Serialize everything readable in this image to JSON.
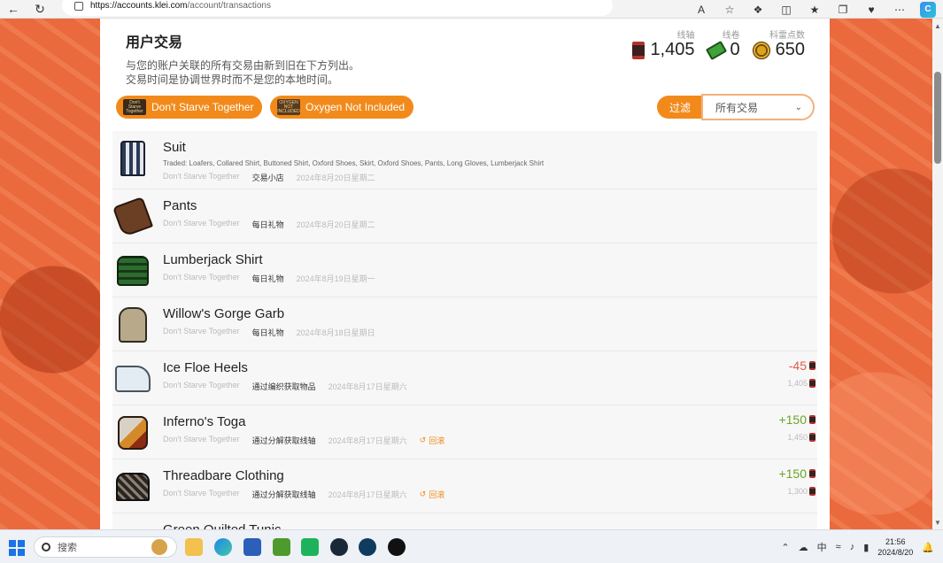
{
  "browser": {
    "url_host": "https://accounts.klei.com",
    "url_path": "/account/transactions",
    "icons": [
      "back-icon",
      "refresh-icon",
      "read-aloud-icon",
      "favorite-icon",
      "extensions-icon",
      "split-screen-icon",
      "favorites-icon",
      "collections-icon",
      "performance-icon",
      "more-icon",
      "copilot-icon"
    ]
  },
  "page": {
    "title": "用户交易",
    "desc_line1": "与您的账户关联的所有交易由新到旧在下方列出。",
    "desc_line2": "交易时间是协调世界时而不是您的本地时间。"
  },
  "balances": [
    {
      "label": "线轴",
      "value": "1,405",
      "icon": "spool-icon"
    },
    {
      "label": "线卷",
      "value": "0",
      "icon": "ticket-icon"
    },
    {
      "label": "科雷点数",
      "value": "650",
      "icon": "klei-points-icon"
    }
  ],
  "filters": {
    "games": [
      {
        "label": "Don't Starve Together",
        "logo_text": "Don't Starve Together"
      },
      {
        "label": "Oxygen Not Included",
        "logo_text": "OXYGEN NOT INCLUDED"
      }
    ],
    "filter_label": "过滤",
    "filter_value": "所有交易"
  },
  "transactions": [
    {
      "title": "Suit",
      "detail": "Traded: Loafers, Collared Shirt, Buttoned Shirt, Oxford Shoes, Skirt, Oxford Shoes, Pants, Long Gloves, Lumberjack Shirt",
      "game": "Don't Starve Together",
      "type": "交易小店",
      "date": "2024年8月20日星期二"
    },
    {
      "title": "Pants",
      "game": "Don't Starve Together",
      "type": "每日礼物",
      "date": "2024年8月20日星期二"
    },
    {
      "title": "Lumberjack Shirt",
      "game": "Don't Starve Together",
      "type": "每日礼物",
      "date": "2024年8月19日星期一"
    },
    {
      "title": "Willow's Gorge Garb",
      "game": "Don't Starve Together",
      "type": "每日礼物",
      "date": "2024年8月18日星期日"
    },
    {
      "title": "Ice Floe Heels",
      "game": "Don't Starve Together",
      "type": "通过编织获取物品",
      "date": "2024年8月17日星期六",
      "amount": "-45",
      "balance_after": "1,405"
    },
    {
      "title": "Inferno's Toga",
      "game": "Don't Starve Together",
      "type": "通过分解获取线轴",
      "date": "2024年8月17日星期六",
      "rollback": "回滚",
      "amount": "+150",
      "balance_after": "1,450"
    },
    {
      "title": "Threadbare Clothing",
      "game": "Don't Starve Together",
      "type": "通过分解获取线轴",
      "date": "2024年8月17日星期六",
      "rollback": "回滚",
      "amount": "+150",
      "balance_after": "1,300"
    },
    {
      "title": "Green Quilted Tunic"
    }
  ],
  "taskbar": {
    "search_placeholder": "搜索",
    "time": "21:56",
    "date": "2024/8/20",
    "ime": "中"
  }
}
